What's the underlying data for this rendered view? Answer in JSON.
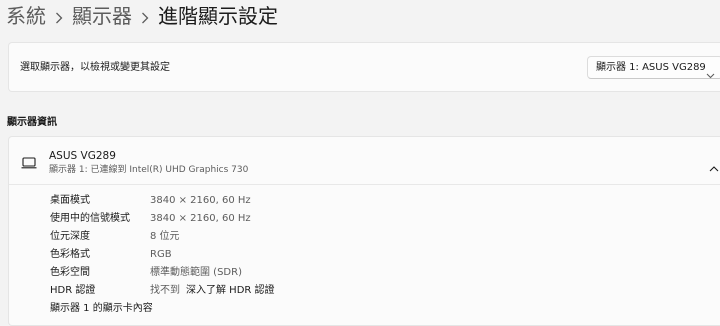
{
  "breadcrumb": {
    "items": [
      "系統",
      "顯示器",
      "進階顯示設定"
    ]
  },
  "select_display": {
    "label": "選取顯示器，以檢視或變更其設定",
    "dropdown_value": "顯示器 1: ASUS VG289"
  },
  "display_info": {
    "section_title": "顯示器資訊",
    "name": "ASUS VG289",
    "subtitle": "顯示器 1: 已連線到 Intel(R) UHD Graphics 730",
    "rows": [
      {
        "label": "桌面模式",
        "value": "3840 × 2160, 60 Hz"
      },
      {
        "label": "使用中的信號模式",
        "value": "3840 × 2160, 60 Hz"
      },
      {
        "label": "位元深度",
        "value": "8 位元"
      },
      {
        "label": "色彩格式",
        "value": "RGB"
      },
      {
        "label": "色彩空間",
        "value": "標準動態範圍 (SDR)"
      },
      {
        "label": "HDR 認證",
        "value": "找不到",
        "link": "深入了解 HDR 認證"
      },
      {
        "label": "顯示器 1 的顯示卡內容",
        "value": ""
      }
    ]
  },
  "icons": {
    "monitor": "monitor-icon",
    "dropdown": "chevron-down-icon",
    "collapse": "chevron-up-icon",
    "separator": "chevron-right-icon"
  }
}
